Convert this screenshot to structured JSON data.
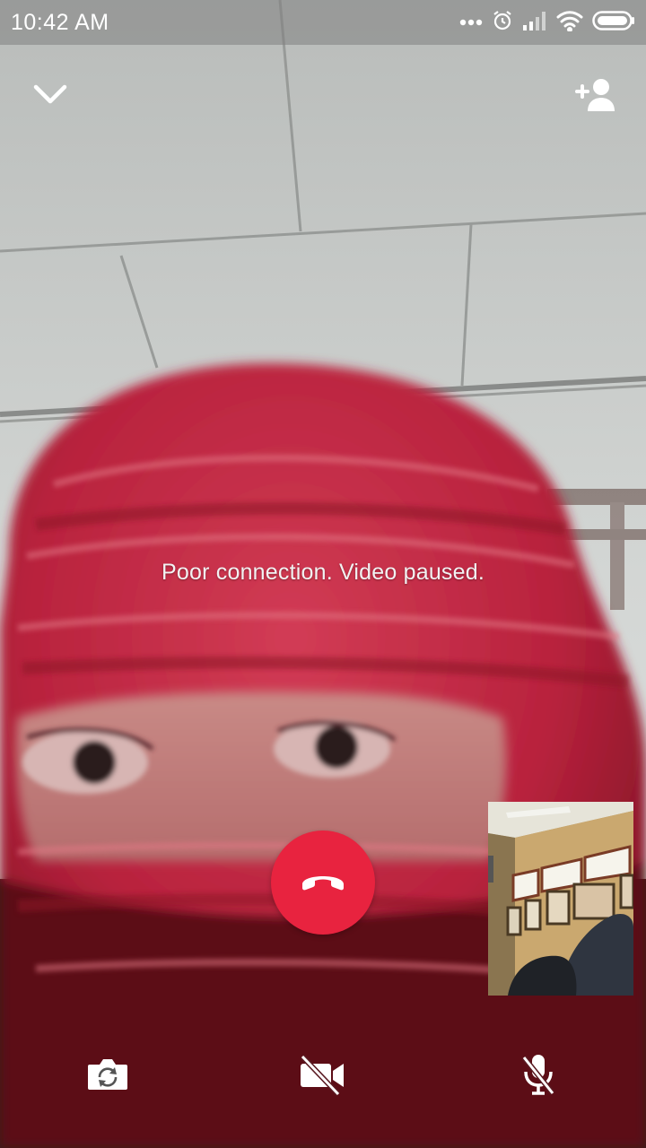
{
  "status_bar": {
    "time": "10:42 AM",
    "icons": [
      "more-dots-icon",
      "alarm-icon",
      "signal-icon",
      "wifi-icon",
      "battery-icon"
    ]
  },
  "header": {
    "minimize_icon": "chevron-down-icon",
    "add_participant_icon": "add-person-icon"
  },
  "call": {
    "status_message": "Poor connection. Video paused.",
    "end_call_color": "#e8233f"
  },
  "controls": {
    "switch_camera_icon": "camera-switch-icon",
    "video_off_icon": "video-off-icon",
    "mute_icon": "mic-off-icon"
  }
}
